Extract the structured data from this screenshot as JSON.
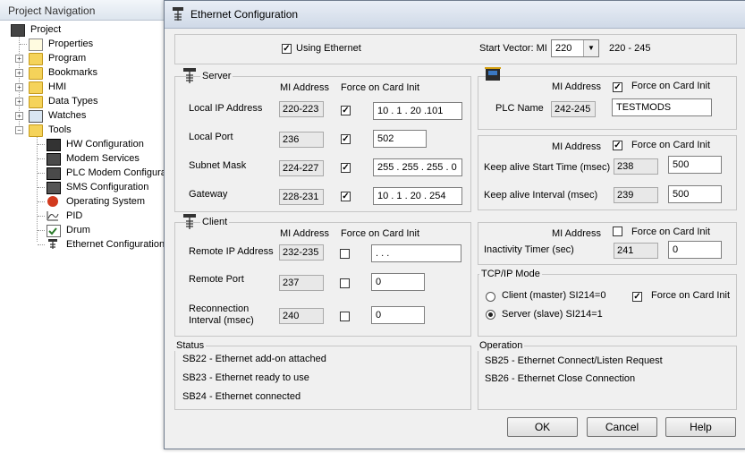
{
  "nav": {
    "header": "Project Navigation",
    "items": [
      {
        "label": "Project"
      },
      {
        "label": "Properties"
      },
      {
        "label": "Program"
      },
      {
        "label": "Bookmarks"
      },
      {
        "label": "HMI"
      },
      {
        "label": "Data Types"
      },
      {
        "label": "Watches"
      },
      {
        "label": "Tools"
      },
      {
        "label": "HW Configuration"
      },
      {
        "label": "Modem Services"
      },
      {
        "label": "PLC Modem Configura"
      },
      {
        "label": "SMS Configuration"
      },
      {
        "label": "Operating System"
      },
      {
        "label": "PID"
      },
      {
        "label": "Drum"
      },
      {
        "label": "Ethernet Configuration"
      }
    ]
  },
  "dialog": {
    "title": "Ethernet Configuration",
    "using_ethernet": "Using Ethernet",
    "start_vector_label": "Start Vector: MI",
    "start_vector_value": "220",
    "start_vector_range": "220 - 245",
    "server": {
      "title": "Server",
      "col_mi": "MI Address",
      "col_force": "Force on Card Init",
      "rows": [
        {
          "label": "Local IP Address",
          "mi": "220-223",
          "value": "10 .  1  . 20 .101"
        },
        {
          "label": "Local Port",
          "mi": "236",
          "value": "502"
        },
        {
          "label": "Subnet Mask",
          "mi": "224-227",
          "value": "255 . 255 . 255 .  0"
        },
        {
          "label": "Gateway",
          "mi": "228-231",
          "value": "10 .  1  . 20 . 254"
        }
      ]
    },
    "client": {
      "title": "Client",
      "col_mi": "MI Address",
      "col_force": "Force on Card Init",
      "rows": [
        {
          "label": "Remote IP Address",
          "mi": "232-235",
          "value": "  .      .      .   "
        },
        {
          "label": "Remote Port",
          "mi": "237",
          "value": "0"
        },
        {
          "label": "Reconnection",
          "label2": "Interval (msec)",
          "mi": "240",
          "value": "0"
        }
      ]
    },
    "plc": {
      "col_mi": "MI Address",
      "col_force": "Force on Card Init",
      "label": "PLC Name",
      "mi": "242-245",
      "value": "TESTMODS"
    },
    "keepalive": {
      "col_mi": "MI Address",
      "col_force": "Force on Card Init",
      "rows": [
        {
          "label": "Keep alive Start Time (msec)",
          "mi": "238",
          "value": "500"
        },
        {
          "label": "Keep alive Interval (msec)",
          "mi": "239",
          "value": "500"
        }
      ]
    },
    "inactivity": {
      "col_mi": "MI Address",
      "col_force": "Force on Card Init",
      "label": "Inactivity Timer (sec)",
      "mi": "241",
      "value": "0"
    },
    "tcp": {
      "title": "TCP/IP Mode",
      "client": "Client (master)   SI214=0",
      "server": "Server (slave)   SI214=1",
      "force": "Force on Card Init"
    },
    "status": {
      "title": "Status",
      "lines": [
        "SB22 - Ethernet add-on attached",
        "SB23 - Ethernet ready to use",
        "SB24 - Ethernet connected"
      ]
    },
    "operation": {
      "title": "Operation",
      "lines": [
        "SB25 - Ethernet Connect/Listen Request",
        "SB26 - Ethernet Close Connection"
      ]
    },
    "buttons": {
      "ok": "OK",
      "cancel": "Cancel",
      "help": "Help"
    }
  }
}
